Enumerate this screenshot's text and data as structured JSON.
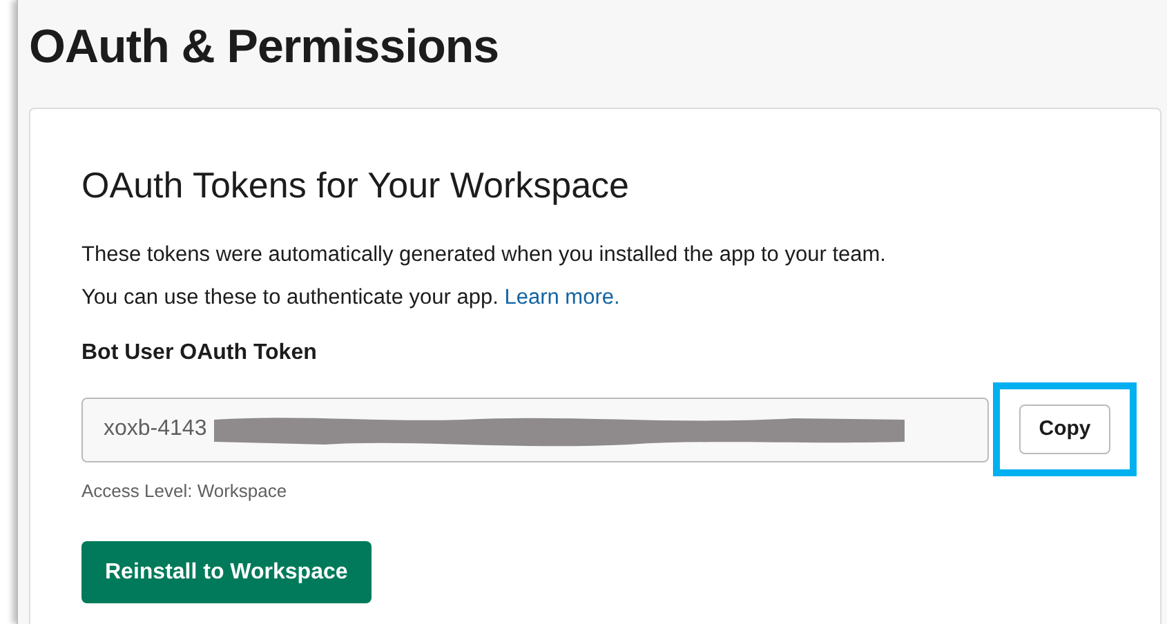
{
  "page_title": "OAuth & Permissions",
  "card": {
    "title": "OAuth Tokens for Your Workspace",
    "description_lines": [
      "These tokens were automatically generated when you installed the app to your team.",
      "You can use these to authenticate your app."
    ],
    "link": "Learn more.",
    "token_label": "Bot User OAuth Token",
    "token_value": "xoxb-4143",
    "token_redacted": true,
    "copy_button": "Copy",
    "copy_highlighted": true,
    "access_level": "Access Level: Workspace",
    "reinstall_button": "Reinstall to Workspace"
  }
}
